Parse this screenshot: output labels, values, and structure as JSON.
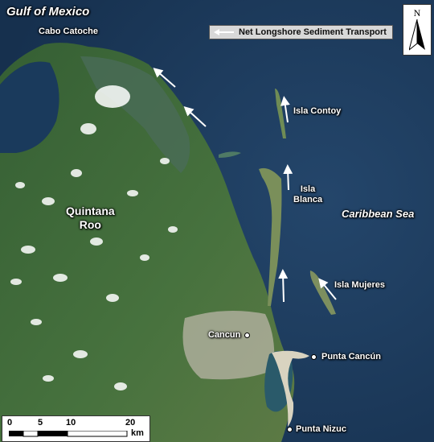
{
  "map": {
    "title": "Gulf of Mexico",
    "places": {
      "cabo_catoche": "Cabo Catoche",
      "quintana_roo_1": "Quintana",
      "quintana_roo_2": "Roo",
      "isla_contoy": "Isla Contoy",
      "isla_blanca_1": "Isla",
      "isla_blanca_2": "Blanca",
      "caribbean_sea": "Caribbean Sea",
      "isla_mujeres": "Isla Mujeres",
      "cancun": "Cancun",
      "punta_cancun": "Punta Cancún",
      "punta_nizuc": "Punta Nizuc"
    },
    "legend": {
      "label": "Net Longshore Sediment Transport",
      "icon": "arrow-left-icon"
    },
    "north_arrow": {
      "letter": "N",
      "icon": "north-arrow-icon"
    },
    "scale_bar": {
      "ticks": [
        "0",
        "5",
        "10",
        "20"
      ],
      "unit": "km"
    },
    "colors": {
      "water": "#1e3d5f",
      "land": "#3f6a3c",
      "urban": "#c9c4b5",
      "label": "#ffffff"
    }
  }
}
